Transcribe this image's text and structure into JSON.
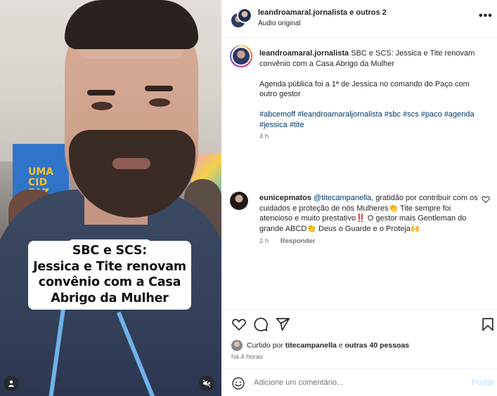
{
  "video": {
    "banner_text": "UMA CID PAZ",
    "caption_lines": [
      "SBC e SCS:",
      "Jessica e Tite renovam",
      "convênio com a Casa",
      "Abrigo da Mulher"
    ],
    "user_icon": "user-icon",
    "mute_icon": "muted-speaker-icon"
  },
  "header": {
    "title": "leandroamaral.jornalista e outros 2",
    "subtitle": "Áudio original",
    "more_icon": "more-options-icon"
  },
  "caption": {
    "username": "leandroamaral.jornalista",
    "text": "SBC e SCS: Jessica e Tite renovam convênio com a Casa Abrigo da Mulher",
    "paragraph2": "Agenda pública foi a 1ª de Jessica no comando do Paço com outro gestor",
    "hashtags": [
      "#abcemoff",
      "#leandroamaraljornalista",
      "#sbc",
      "#scs",
      "#paco",
      "#agenda",
      "#jessica",
      "#tite"
    ],
    "time": "4 h"
  },
  "comment": {
    "username": "eunicepmatos",
    "mention": "@titecampanella",
    "text1": ", gratidão por contribuir com os cuidados e proteção de nós Mulheres",
    "emoji1": "👏",
    "text2": " Tite sempre foi atencioso e muito prestativo",
    "emoji2": "‼️",
    "text3": "  O gestor mais Gentleman do grande ABCD",
    "emoji3": "👏",
    "text4": " Deus o Guarde e o Proteja",
    "emoji4": "🙌",
    "time": "2 h",
    "reply": "Responder"
  },
  "actions": {
    "icons": [
      "heart-icon",
      "comment-icon",
      "share-icon",
      "bookmark-icon"
    ],
    "liked_by_prefix": "Curtido por ",
    "liked_by_user": "titecampanella",
    "liked_by_mid": " e ",
    "liked_by_others": "outras 40 pessoas",
    "ago": "há 4 horas"
  },
  "add_comment": {
    "placeholder": "Adicione um comentário...",
    "post_label": "Postar"
  }
}
